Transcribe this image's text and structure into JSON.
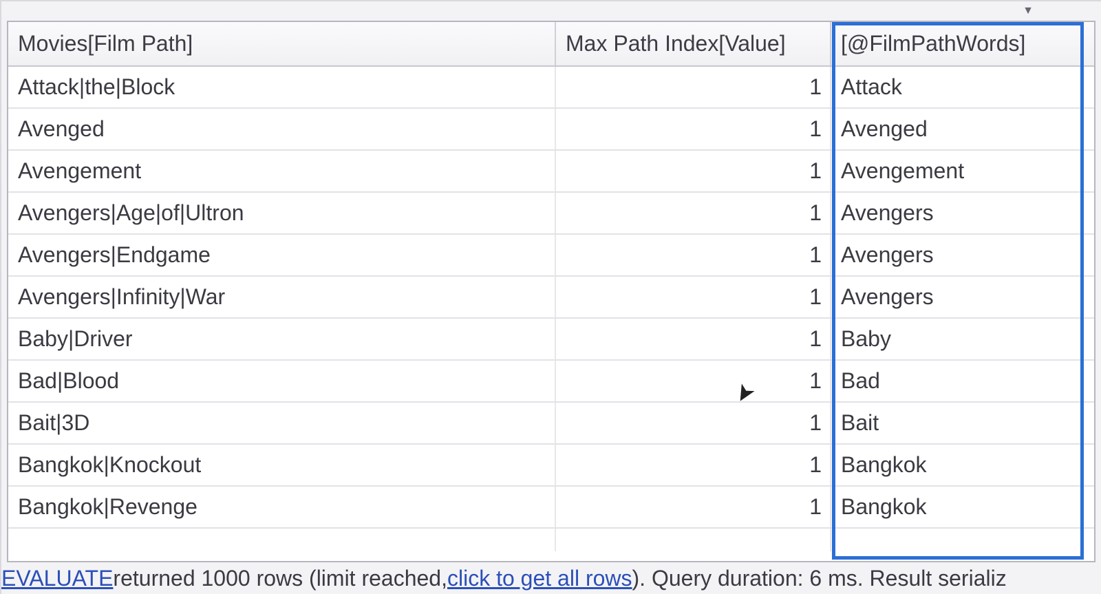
{
  "dropdown": {
    "icon_label": "chevron-down-icon"
  },
  "grid": {
    "columns": [
      {
        "label": "Movies[Film Path]"
      },
      {
        "label": "Max Path Index[Value]"
      },
      {
        "label": "[@FilmPathWords]"
      }
    ],
    "rows": [
      {
        "path": "Attack|the|Block",
        "index": "1",
        "word": "Attack"
      },
      {
        "path": "Avenged",
        "index": "1",
        "word": "Avenged"
      },
      {
        "path": "Avengement",
        "index": "1",
        "word": "Avengement"
      },
      {
        "path": "Avengers|Age|of|Ultron",
        "index": "1",
        "word": "Avengers"
      },
      {
        "path": "Avengers|Endgame",
        "index": "1",
        "word": "Avengers"
      },
      {
        "path": "Avengers|Infinity|War",
        "index": "1",
        "word": "Avengers"
      },
      {
        "path": "Baby|Driver",
        "index": "1",
        "word": "Baby"
      },
      {
        "path": "Bad|Blood",
        "index": "1",
        "word": "Bad"
      },
      {
        "path": "Bait|3D",
        "index": "1",
        "word": "Bait"
      },
      {
        "path": "Bangkok|Knockout",
        "index": "1",
        "word": "Bangkok"
      },
      {
        "path": "Bangkok|Revenge",
        "index": "1",
        "word": "Bangkok"
      }
    ],
    "partial_row": {
      "path": " ",
      "index": " ",
      "word": " "
    }
  },
  "status": {
    "evaluate_label": "EVALUATE",
    "text1": " returned 1000 rows (limit reached, ",
    "click_link": "click to get all rows",
    "text2": "). Query duration: 6 ms. Result serializ"
  }
}
